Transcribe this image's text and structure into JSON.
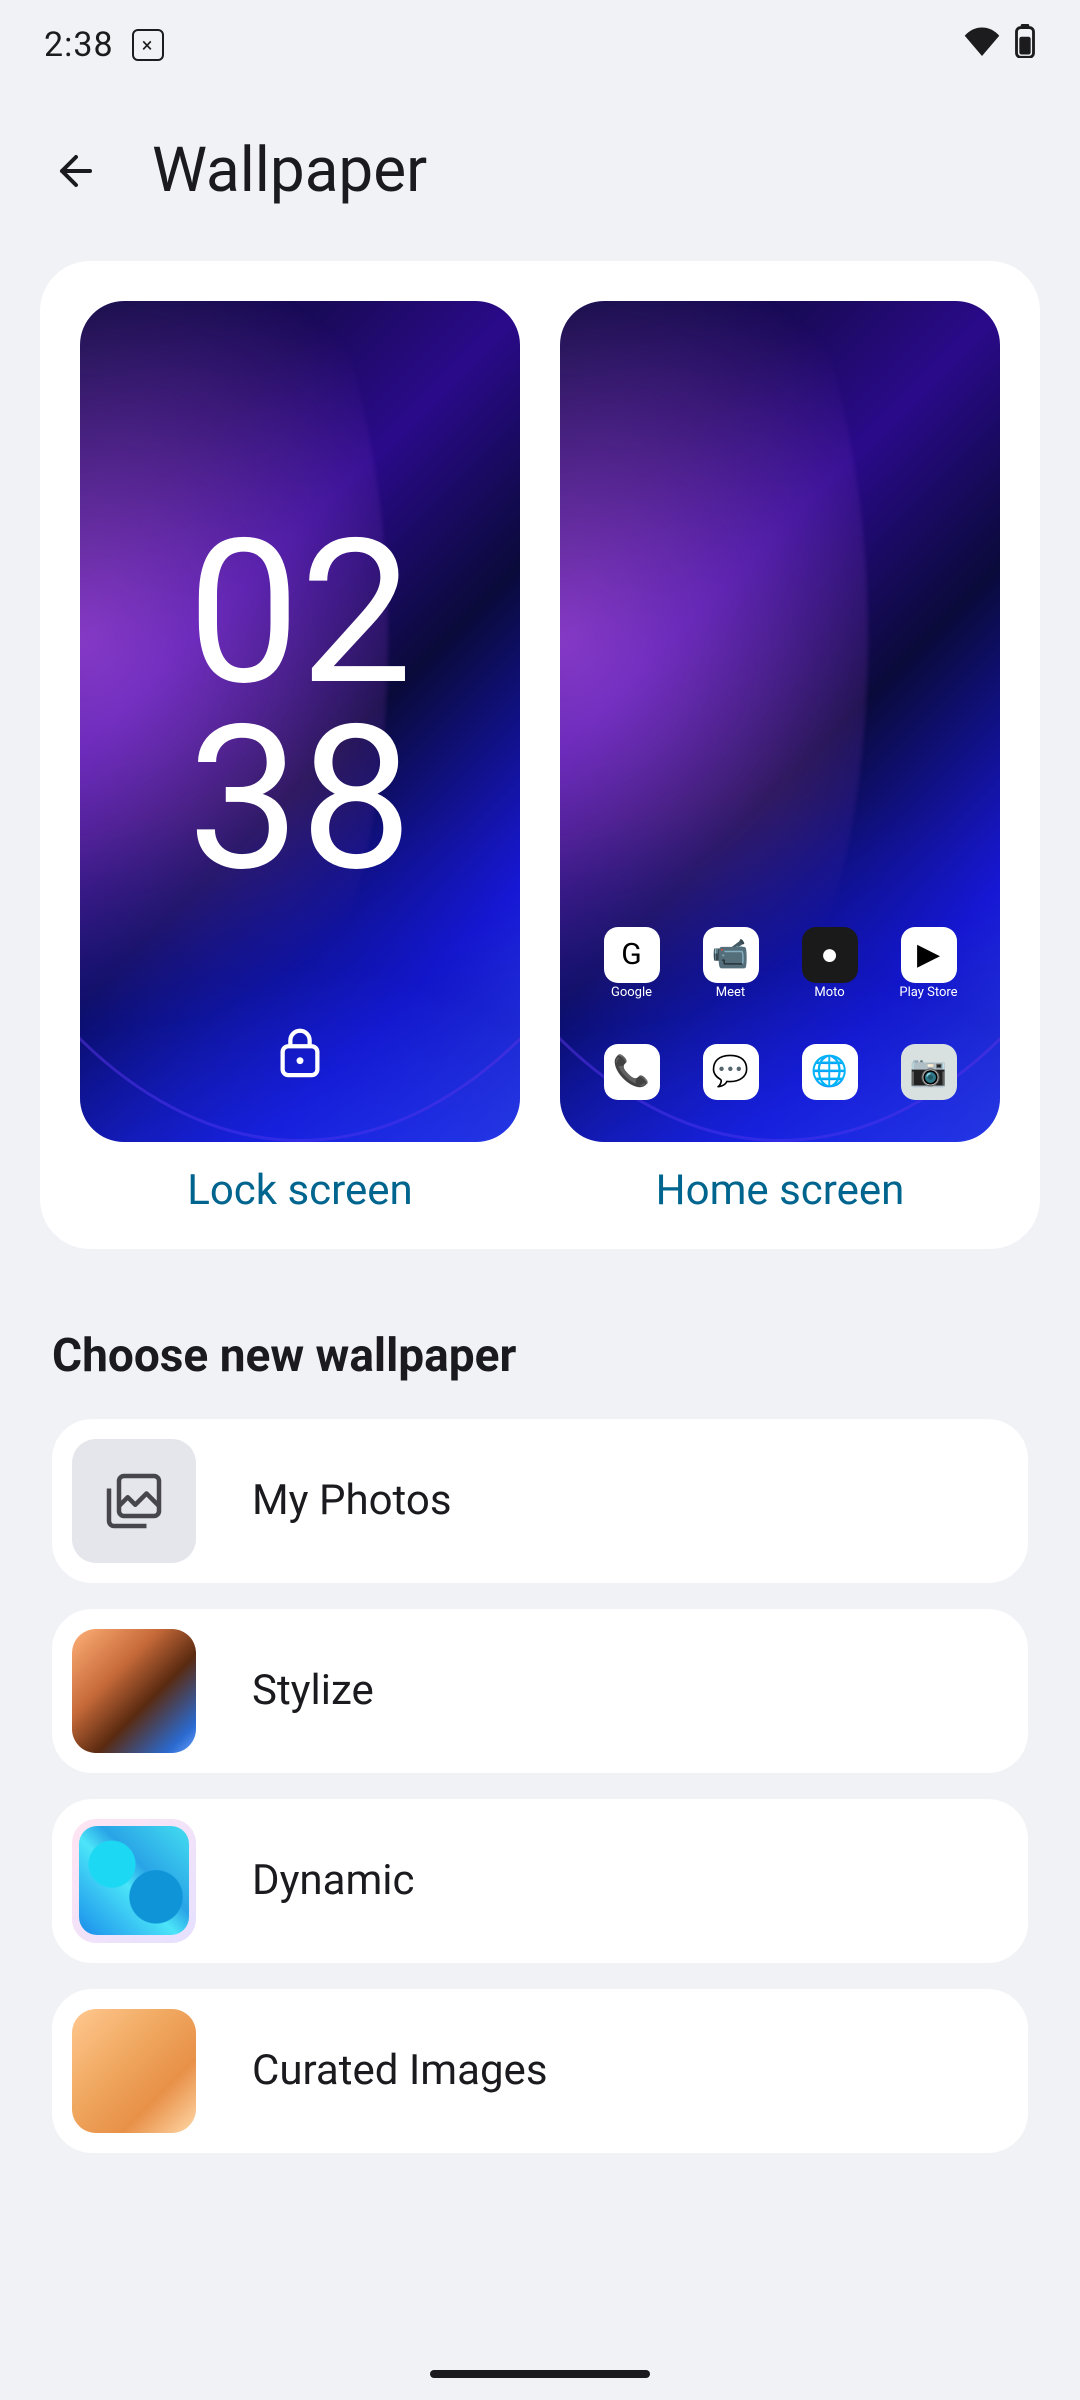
{
  "status": {
    "time": "2:38"
  },
  "header": {
    "title": "Wallpaper"
  },
  "previews": {
    "lock": {
      "label": "Lock screen",
      "clock_h": "02",
      "clock_m": "38"
    },
    "home": {
      "label": "Home screen",
      "row1": [
        {
          "name": "Google",
          "glyph": "G"
        },
        {
          "name": "Meet",
          "glyph": "📹"
        },
        {
          "name": "Moto",
          "glyph": "●"
        },
        {
          "name": "Play Store",
          "glyph": "▶"
        }
      ],
      "row2": [
        {
          "glyph": "📞"
        },
        {
          "glyph": "💬"
        },
        {
          "glyph": "🌐"
        },
        {
          "glyph": "📷"
        }
      ]
    }
  },
  "section": {
    "heading": "Choose new wallpaper"
  },
  "categories": [
    {
      "id": "my-photos",
      "label": "My Photos"
    },
    {
      "id": "stylize",
      "label": "Stylize"
    },
    {
      "id": "dynamic",
      "label": "Dynamic"
    },
    {
      "id": "curated",
      "label": "Curated Images"
    }
  ]
}
